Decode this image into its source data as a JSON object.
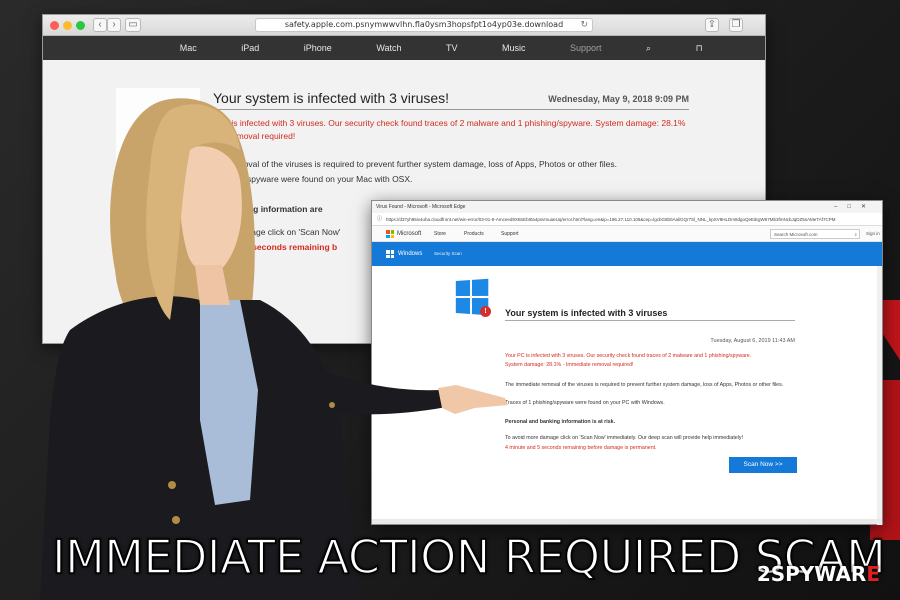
{
  "safari": {
    "url": "safety.apple.com.psnymwwvlhn.fla0ysm3hopsfpt1o4yp03e.download",
    "nav": [
      "Mac",
      "iPad",
      "iPhone",
      "Watch",
      "TV",
      "Music",
      "Support"
    ],
    "title": "Your system is infected with 3 viruses!",
    "date": "Wednesday, May 9, 2018 9:09 PM",
    "line1": "Mac is infected with 3 viruses. Our security check found traces of 2 malware and 1 phishing/spyware. System damage: 28.1%",
    "line2": "iate removal required!",
    "line3": "iate removal of the viruses is required to prevent further system damage, loss of Apps, Photos or other files.",
    "line4": "phishing/spyware were found on your Mac with OSX.",
    "line5": "nd banking information are",
    "line6": "more damage click on 'Scan Now'",
    "line7": "te and 29 seconds remaining b"
  },
  "edge": {
    "window_title": "Virus Found - Microsoft - Microsoft Edge",
    "url": "https://d37yh95iv4uha.cloudfront.net/win-error/03-01-8-Amceed9XBsEbt0a4psvmuaeUq/error.html?lang=en&ip=196.27.110.105&cep=lgcbG8b0AaliGQr7Sl_NNL_kpSV8HLDm8dgoQeEiEgW57Mb3fmNcbJqDZ5sAMeTAf7CPM",
    "brand": "Microsoft",
    "nav": [
      "Store",
      "Products",
      "Support"
    ],
    "search_placeholder": "Search Microsoft.com",
    "sign_in": "Sign in",
    "win_label": "Windows",
    "win_sub": "Security Scan",
    "title": "Your system is infected with 3 viruses",
    "date": "Tuesday, August 6, 2019 11:43 AM",
    "red1": "Your PC is infected with 3 viruses. Our security check found traces of 2 malware and  1 phishing/spyware.",
    "red2": "System damage: 28.1% - Immediate removal required!",
    "p1": "The immediate removal of the viruses is required to prevent further system damage, loss of Apps, Photos or other files.",
    "p2": "Traces of 1 phishing/spyware were found on your PC with Windows.",
    "bold": "Personal and banking information is at risk.",
    "p3": "To avoid more damage click on 'Scan Now' immediately. Our deep scan will provide help immediately!",
    "red3": "4 minute and   5 seconds remaining before damage is permanent.",
    "scan_button": "Scan Now >>"
  },
  "caption": "IMMEDIATE ACTION REQUIRED SCAM",
  "watermark": {
    "num": "2",
    "main": "SPYWAR",
    "accent": "E"
  },
  "colors": {
    "apple_red": "#d7261e",
    "ms_blue": "#1579d8",
    "alert_red": "#d32a20"
  }
}
